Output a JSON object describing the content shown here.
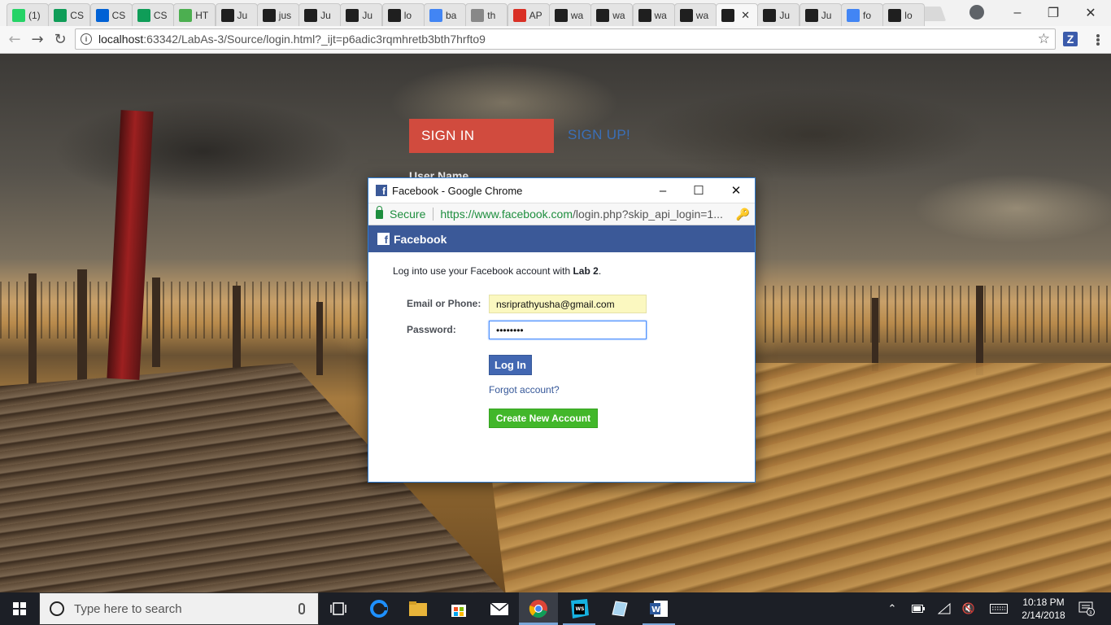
{
  "browser": {
    "tabs": [
      {
        "label": "(1)",
        "icon": "whatsapp-icon",
        "color": "#25d366"
      },
      {
        "label": "CS",
        "icon": "sheets-icon",
        "color": "#0f9d58"
      },
      {
        "label": "CS",
        "icon": "box-icon",
        "color": "#0061d5"
      },
      {
        "label": "CS",
        "icon": "sheets-icon",
        "color": "#0f9d58"
      },
      {
        "label": "HT",
        "icon": "w3schools-icon",
        "color": "#4caf50"
      },
      {
        "label": "Ju",
        "icon": "webstorm-icon",
        "color": "#1f1f1f"
      },
      {
        "label": "jus",
        "icon": "webstorm-icon",
        "color": "#1f1f1f"
      },
      {
        "label": "Ju",
        "icon": "webstorm-icon",
        "color": "#1f1f1f"
      },
      {
        "label": "Ju",
        "icon": "webstorm-icon",
        "color": "#1f1f1f"
      },
      {
        "label": "lo",
        "icon": "webstorm-icon",
        "color": "#1f1f1f"
      },
      {
        "label": "ba",
        "icon": "google-icon",
        "color": "#4285f4"
      },
      {
        "label": "th",
        "icon": "document-icon",
        "color": "#888888"
      },
      {
        "label": "AP",
        "icon": "pdf-icon",
        "color": "#d93025"
      },
      {
        "label": "wa",
        "icon": "webstorm-icon",
        "color": "#1f1f1f"
      },
      {
        "label": "wa",
        "icon": "webstorm-icon",
        "color": "#1f1f1f"
      },
      {
        "label": "wa",
        "icon": "webstorm-icon",
        "color": "#1f1f1f"
      },
      {
        "label": "wa",
        "icon": "webstorm-icon",
        "color": "#1f1f1f"
      },
      {
        "label": "",
        "icon": "webstorm-icon",
        "color": "#1f1f1f",
        "active": true
      },
      {
        "label": "Ju",
        "icon": "webstorm-icon",
        "color": "#1f1f1f"
      },
      {
        "label": "Ju",
        "icon": "webstorm-icon",
        "color": "#1f1f1f"
      },
      {
        "label": "fo",
        "icon": "google-icon",
        "color": "#4285f4"
      },
      {
        "label": "lo",
        "icon": "webstorm-icon",
        "color": "#1f1f1f"
      }
    ],
    "active_tab_close": "✕",
    "url_host": "localhost",
    "url_rest": ":63342/LabAs-3/Source/login.html?_ijt=p6adic3rqmhretb3bth7hrfto9",
    "extension_label": "Z"
  },
  "page": {
    "signin_tab": "SIGN IN",
    "signup_tab": "SIGN UP!",
    "username_label": "User Name"
  },
  "popup": {
    "title": "Facebook - Google Chrome",
    "secure_label": "Secure",
    "url_host": "https://www.facebook.com",
    "url_path": "/login.php?skip_api_login=1...",
    "brand_bar": "Facebook",
    "intro_prefix": "Log into use your Facebook account with ",
    "intro_app": "Lab 2",
    "intro_suffix": ".",
    "email_label": "Email or Phone:",
    "email_value": "nsriprathyusha@gmail.com",
    "password_label": "Password:",
    "password_value": "••••••••",
    "login_button": "Log In",
    "forgot_link": "Forgot account?",
    "create_button": "Create New Account"
  },
  "taskbar": {
    "search_placeholder": "Type here to search",
    "time": "10:18 PM",
    "date": "2/14/2018",
    "notification_count": "3"
  }
}
